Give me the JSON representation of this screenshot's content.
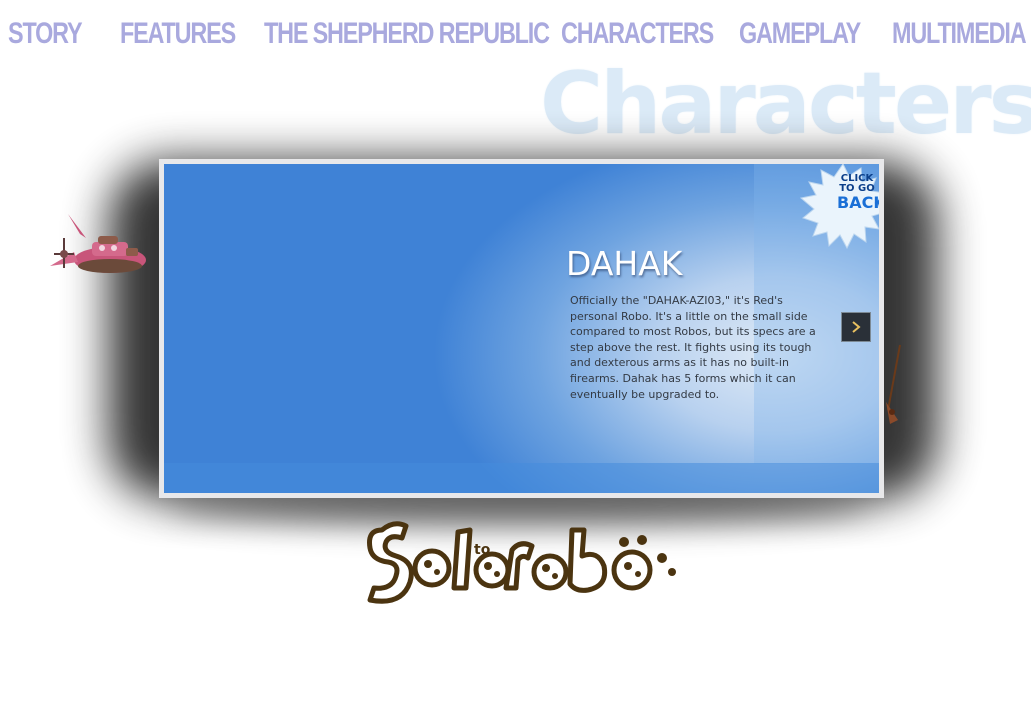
{
  "nav": {
    "items": [
      {
        "label": "STORY"
      },
      {
        "label": "FEATURES"
      },
      {
        "label": "THE SHEPHERD REPUBLIC"
      },
      {
        "label": "CHARACTERS"
      },
      {
        "label": "GAMEPLAY"
      },
      {
        "label": "MULTIMEDIA"
      }
    ]
  },
  "page": {
    "heading": "Characters"
  },
  "character": {
    "name": "DAHAK",
    "description": "Officially the \"DAHAK-AZI03,\" it's Red's personal Robo. It's a little on the small side compared to most Robos, but its specs are a step above the rest. It fights using its tough and dexterous arms as it has no built-in firearms. Dahak has 5 forms which it can eventually be upgraded to."
  },
  "back_badge": {
    "line1": "CLICK",
    "line2": "TO GO",
    "line3": "BACK"
  },
  "icons": {
    "next": "chevron-right-icon",
    "back": "starburst-icon"
  },
  "logo": {
    "text": "Sola to robo"
  },
  "colors": {
    "nav": "#a9a9de",
    "heading": "#dbeaf7",
    "panel_blue": "#3f82d6",
    "logo_brown": "#4b3410"
  }
}
